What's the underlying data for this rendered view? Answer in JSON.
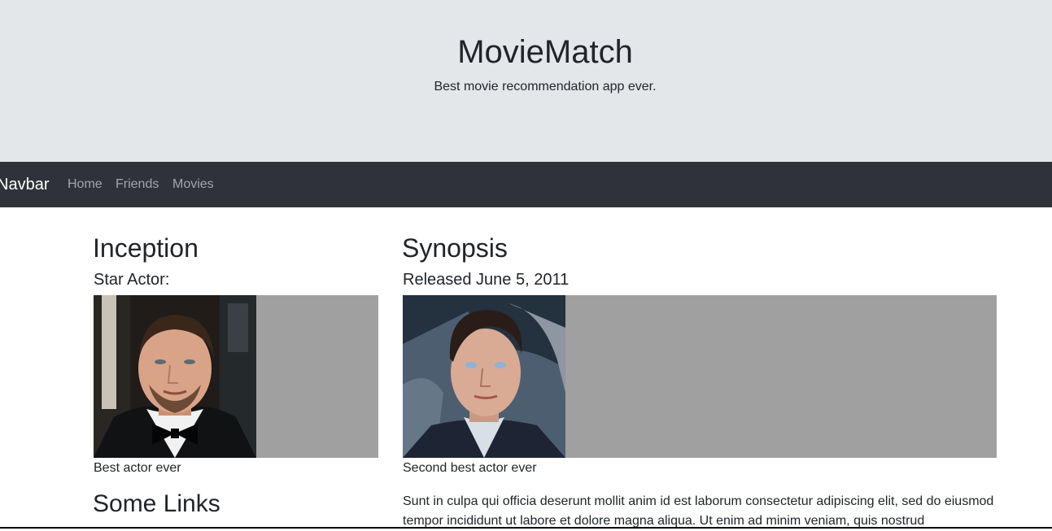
{
  "header": {
    "title": "MovieMatch",
    "tagline": "Best movie recommendation app ever."
  },
  "navbar": {
    "brand": "Navbar",
    "links": [
      "Home",
      "Friends",
      "Movies"
    ]
  },
  "left": {
    "title": "Inception",
    "subtitle": "Star Actor:",
    "caption": "Best actor ever",
    "links_heading": "Some Links"
  },
  "right": {
    "title": "Synopsis",
    "subtitle": "Released June 5, 2011",
    "caption": "Second best actor ever",
    "paragraph": "Sunt in culpa qui officia deserunt mollit anim id est laborum consectetur adipiscing elit, sed do eiusmod tempor incididunt ut labore et dolore magna aliqua. Ut enim ad minim veniam, quis nostrud"
  },
  "colors": {
    "hero_bg": "#e4e7ea",
    "navbar_bg": "#2f3339",
    "image_placeholder": "#a0a0a0"
  }
}
